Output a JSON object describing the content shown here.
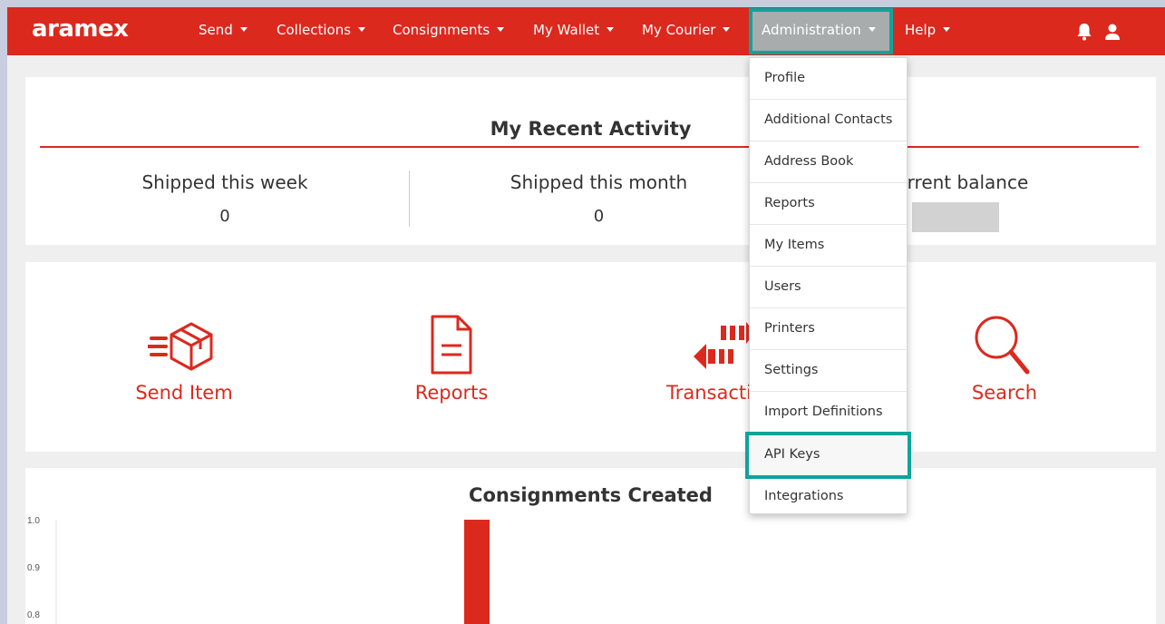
{
  "brand": {
    "logo_text": "aramex",
    "accent_color": "#dc291e",
    "highlight_color": "#0fa39a"
  },
  "navbar": {
    "items": [
      {
        "label": "Send"
      },
      {
        "label": "Collections"
      },
      {
        "label": "Consignments"
      },
      {
        "label": "My Wallet"
      },
      {
        "label": "My Courier"
      },
      {
        "label": "Administration",
        "active": true
      },
      {
        "label": "Help"
      }
    ],
    "icons": [
      "bell-icon",
      "user-icon"
    ]
  },
  "activity": {
    "title": "My Recent Activity",
    "stats": [
      {
        "label": "Shipped this week",
        "value": "0"
      },
      {
        "label": "Shipped this month",
        "value": "0"
      },
      {
        "label": "urrent balance",
        "value": ""
      }
    ]
  },
  "actions": [
    {
      "label": "Send Item",
      "icon": "send-box-icon"
    },
    {
      "label": "Reports",
      "icon": "document-icon"
    },
    {
      "label": "Transacti",
      "icon": "transactions-arrows-icon"
    },
    {
      "label": "Search",
      "icon": "search-icon"
    }
  ],
  "admin_menu": {
    "items": [
      "Profile",
      "Additional Contacts",
      "Address Book",
      "Reports",
      "My Items",
      "Users",
      "Printers",
      "Settings",
      "Import Definitions",
      "API Keys",
      "Integrations"
    ],
    "highlighted": "API Keys"
  },
  "chart_data": {
    "type": "bar",
    "title": "Consignments Created",
    "ytick_labels": [
      "1.0",
      "0.9",
      "0.8"
    ],
    "bar_color": "#dc291e",
    "values": [
      1.0
    ],
    "ylim_visible": [
      0.8,
      1.0
    ]
  }
}
